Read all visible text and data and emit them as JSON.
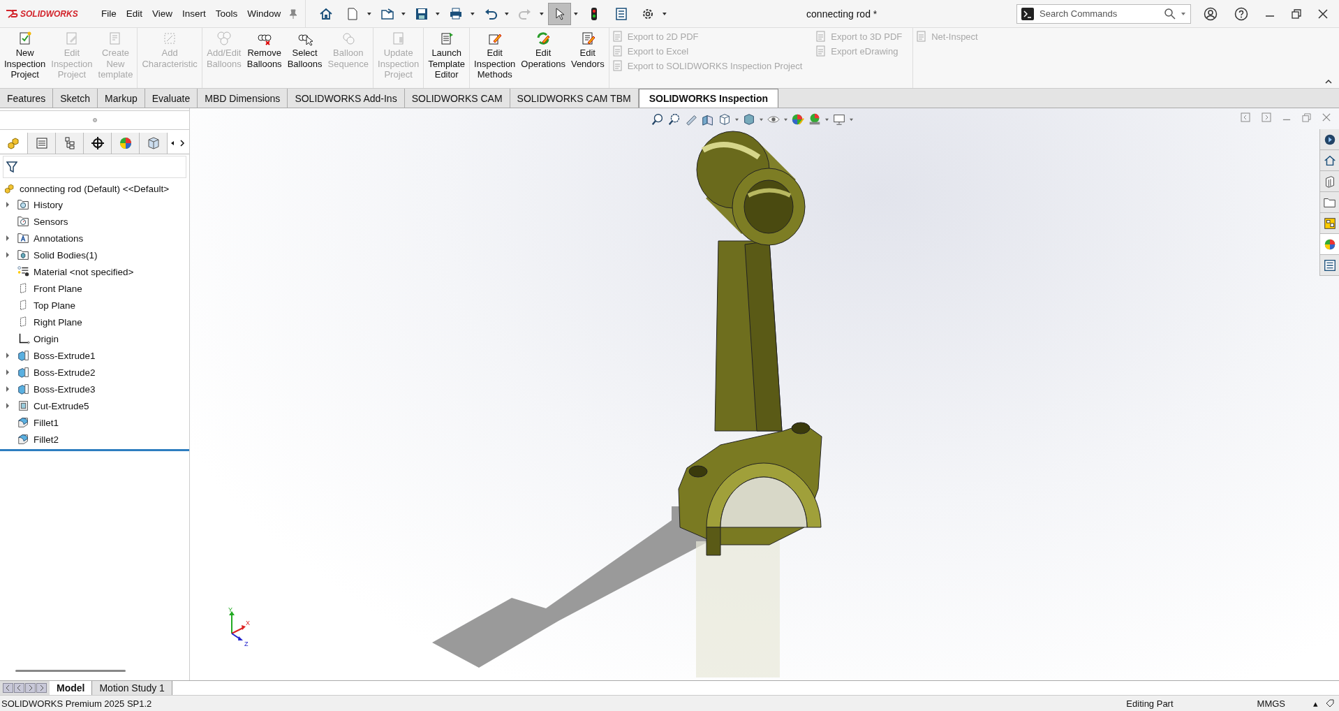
{
  "app_name": "SOLIDWORKS",
  "menus": [
    "File",
    "Edit",
    "View",
    "Insert",
    "Tools",
    "Window"
  ],
  "quick_access": [
    {
      "kind": "home",
      "dropdown": false,
      "selected": false
    },
    {
      "kind": "new",
      "dropdown": true,
      "selected": false
    },
    {
      "kind": "open",
      "dropdown": true,
      "selected": false
    },
    {
      "kind": "save",
      "dropdown": true,
      "selected": false
    },
    {
      "kind": "print",
      "dropdown": true,
      "selected": false
    },
    {
      "kind": "undo",
      "dropdown": true,
      "selected": false
    },
    {
      "kind": "redo",
      "dropdown": true,
      "selected": false
    },
    {
      "kind": "select",
      "dropdown": true,
      "selected": true
    },
    {
      "kind": "rebuild",
      "dropdown": false,
      "selected": false
    },
    {
      "kind": "file-props",
      "dropdown": false,
      "selected": false
    },
    {
      "kind": "options",
      "dropdown": true,
      "selected": false
    }
  ],
  "window": {
    "title": "connecting rod *"
  },
  "search": {
    "placeholder": "Search Commands"
  },
  "ribbon": {
    "groups": [
      {
        "buttons": [
          {
            "lines": [
              "New",
              "Inspection",
              "Project"
            ],
            "disabled": false
          },
          {
            "lines": [
              "Edit",
              "Inspection",
              "Project"
            ],
            "disabled": true
          },
          {
            "lines": [
              "Create",
              "New",
              "template"
            ],
            "disabled": true
          }
        ]
      },
      {
        "buttons": [
          {
            "lines": [
              "Add",
              "Characteristic"
            ],
            "disabled": true
          }
        ]
      },
      {
        "buttons": [
          {
            "lines": [
              "Add/Edit",
              "Balloons"
            ],
            "disabled": true
          },
          {
            "lines": [
              "Remove",
              "Balloons"
            ],
            "disabled": false
          },
          {
            "lines": [
              "Select",
              "Balloons"
            ],
            "disabled": false
          },
          {
            "lines": [
              "Balloon",
              "Sequence"
            ],
            "disabled": true
          }
        ]
      },
      {
        "buttons": [
          {
            "lines": [
              "Update",
              "Inspection",
              "Project"
            ],
            "disabled": true
          }
        ]
      },
      {
        "buttons": [
          {
            "lines": [
              "Launch",
              "Template",
              "Editor"
            ],
            "disabled": false
          }
        ]
      },
      {
        "buttons": [
          {
            "lines": [
              "Edit",
              "Inspection",
              "Methods"
            ],
            "disabled": false
          },
          {
            "lines": [
              "Edit",
              "Operations"
            ],
            "disabled": false
          },
          {
            "lines": [
              "Edit",
              "Vendors"
            ],
            "disabled": false
          }
        ]
      }
    ],
    "export_columns": [
      [
        {
          "label": "Export to 2D PDF",
          "disabled": true
        },
        {
          "label": "Export to Excel",
          "disabled": true
        },
        {
          "label": "Export to SOLIDWORKS Inspection Project",
          "disabled": true
        }
      ],
      [
        {
          "label": "Export to 3D PDF",
          "disabled": true
        },
        {
          "label": "Export eDrawing",
          "disabled": true
        }
      ],
      [
        {
          "label": "Net-Inspect",
          "disabled": true
        }
      ]
    ]
  },
  "tabs": [
    {
      "label": "Features",
      "selected": false
    },
    {
      "label": "Sketch",
      "selected": false
    },
    {
      "label": "Markup",
      "selected": false
    },
    {
      "label": "Evaluate",
      "selected": false
    },
    {
      "label": "MBD Dimensions",
      "selected": false
    },
    {
      "label": "SOLIDWORKS Add-Ins",
      "selected": false
    },
    {
      "label": "SOLIDWORKS CAM",
      "selected": false
    },
    {
      "label": "SOLIDWORKS CAM TBM",
      "selected": false
    },
    {
      "label": "SOLIDWORKS Inspection",
      "selected": true
    }
  ],
  "panel_tabs": [
    {
      "kind": "feature-tree",
      "selected": true
    },
    {
      "kind": "properties",
      "selected": false
    },
    {
      "kind": "config",
      "selected": false
    },
    {
      "kind": "dimxpert",
      "selected": false
    },
    {
      "kind": "appearance",
      "selected": false
    },
    {
      "kind": "cam",
      "selected": false
    }
  ],
  "tree": {
    "root": "connecting rod (Default) <<Default>",
    "items": [
      {
        "label": "History",
        "kind": "history",
        "expandable": true
      },
      {
        "label": "Sensors",
        "kind": "sensors",
        "expandable": false
      },
      {
        "label": "Annotations",
        "kind": "annotations",
        "expandable": true
      },
      {
        "label": "Solid Bodies(1)",
        "kind": "bodies",
        "expandable": true
      },
      {
        "label": "Material <not specified>",
        "kind": "material",
        "expandable": false
      },
      {
        "label": "Front Plane",
        "kind": "plane",
        "expandable": false
      },
      {
        "label": "Top Plane",
        "kind": "plane",
        "expandable": false
      },
      {
        "label": "Right Plane",
        "kind": "plane",
        "expandable": false
      },
      {
        "label": "Origin",
        "kind": "origin",
        "expandable": false
      },
      {
        "label": "Boss-Extrude1",
        "kind": "boss",
        "expandable": true
      },
      {
        "label": "Boss-Extrude2",
        "kind": "boss",
        "expandable": true
      },
      {
        "label": "Boss-Extrude3",
        "kind": "boss",
        "expandable": true
      },
      {
        "label": "Cut-Extrude5",
        "kind": "cut",
        "expandable": true
      },
      {
        "label": "Fillet1",
        "kind": "fillet",
        "expandable": false
      },
      {
        "label": "Fillet2",
        "kind": "fillet",
        "expandable": false
      }
    ]
  },
  "heads_up": [
    {
      "kind": "zoom-fit",
      "dropdown": false
    },
    {
      "kind": "zoom-area",
      "dropdown": false
    },
    {
      "kind": "previous-view",
      "dropdown": false
    },
    {
      "kind": "section",
      "dropdown": false
    },
    {
      "kind": "view-orient",
      "dropdown": true
    },
    {
      "kind": "display-style",
      "dropdown": true
    },
    {
      "kind": "hide-show",
      "dropdown": true
    },
    {
      "kind": "edit-appearance",
      "dropdown": false
    },
    {
      "kind": "scene",
      "dropdown": true
    },
    {
      "kind": "view-settings",
      "dropdown": true
    }
  ],
  "triad": {
    "y": "Y",
    "x": "X",
    "z": "Z"
  },
  "task_pane": [
    {
      "kind": "resources",
      "selected": false
    },
    {
      "kind": "home",
      "selected": false
    },
    {
      "kind": "library",
      "selected": false
    },
    {
      "kind": "explorer",
      "selected": false
    },
    {
      "kind": "palette",
      "selected": false
    },
    {
      "kind": "appearances",
      "selected": true
    },
    {
      "kind": "custom-props",
      "selected": false
    }
  ],
  "bottom_tabs": [
    {
      "label": "Model",
      "selected": true
    },
    {
      "label": "Motion Study 1",
      "selected": false
    }
  ],
  "status_bar": {
    "product": "SOLIDWORKS Premium 2025 SP1.2",
    "mode": "Editing Part",
    "units": "MMGS",
    "caret": "▴"
  }
}
